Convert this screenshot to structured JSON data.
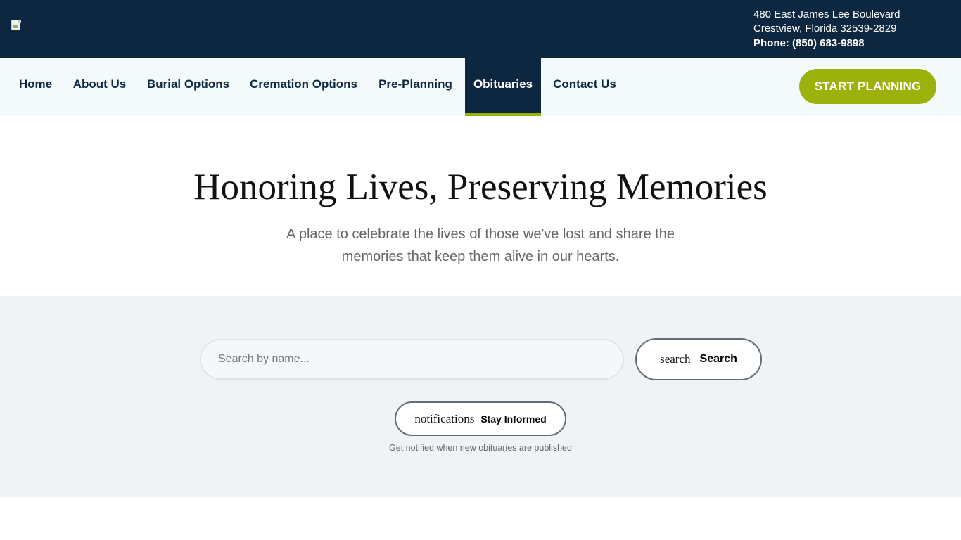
{
  "header": {
    "address_line1": "480 East James Lee Boulevard",
    "address_line2": "Crestview, Florida 32539-2829",
    "phone": "Phone: (850) 683-9898"
  },
  "nav": {
    "items": [
      {
        "label": "Home"
      },
      {
        "label": "About Us"
      },
      {
        "label": "Burial Options"
      },
      {
        "label": "Cremation Options"
      },
      {
        "label": "Pre-Planning"
      },
      {
        "label": "Obituaries",
        "active": true
      },
      {
        "label": "Contact Us"
      }
    ],
    "cta_label": "START PLANNING"
  },
  "hero": {
    "title": "Honoring Lives, Preserving Memories",
    "subtitle": "A place to celebrate the lives of those we've lost and share the memories that keep them alive in our hearts."
  },
  "search": {
    "placeholder": "Search by name...",
    "value": "",
    "button_icon": "search",
    "button_label": "Search"
  },
  "notify": {
    "button_icon": "notifications",
    "button_label": "Stay Informed",
    "note": "Get notified when new obituaries are published"
  },
  "colors": {
    "header_bg": "#0e2740",
    "nav_bg": "#f4f9fc",
    "accent": "#9bb20c",
    "search_band_bg": "#f0f3f5"
  }
}
